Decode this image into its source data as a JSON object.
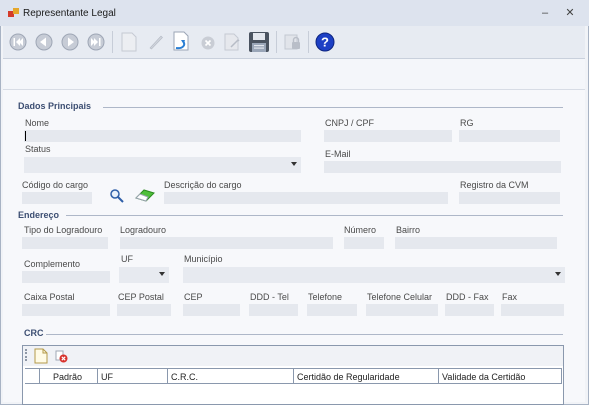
{
  "window": {
    "title": "Representante Legal",
    "minimize": "–",
    "close": "✕"
  },
  "toolbar": {
    "buttons": [
      "first",
      "previous",
      "next",
      "last",
      "new",
      "edit",
      "undo",
      "cancel",
      "delete",
      "save",
      "lock",
      "help"
    ]
  },
  "sections": {
    "dados_principais": "Dados Principais",
    "endereco": "Endereço",
    "crc": "CRC"
  },
  "fields": {
    "nome": "Nome",
    "cnpj_cpf": "CNPJ / CPF",
    "rg": "RG",
    "status": "Status",
    "email": "E-Mail",
    "codigo_cargo": "Código do cargo",
    "descricao_cargo": "Descrição do cargo",
    "registro_cvm": "Registro da CVM",
    "tipo_logradouro": "Tipo do Logradouro",
    "logradouro": "Logradouro",
    "numero": "Número",
    "bairro": "Bairro",
    "complemento": "Complemento",
    "uf": "UF",
    "municipio": "Município",
    "caixa_postal": "Caixa Postal",
    "cep_postal": "CEP Postal",
    "cep": "CEP",
    "ddd_tel": "DDD - Tel",
    "telefone": "Telefone",
    "telefone_celular": "Telefone Celular",
    "ddd_fax": "DDD - Fax",
    "fax": "Fax"
  },
  "grid": {
    "columns": [
      "Padrão",
      "UF",
      "C.R.C.",
      "Certidão de Regularidade",
      "Validade da Certidão"
    ]
  },
  "colors": {
    "accent": "#3c4e72",
    "help": "#1d3fc4"
  }
}
